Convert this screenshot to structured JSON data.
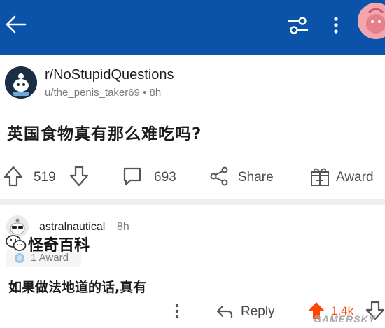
{
  "colors": {
    "header": "#0b53a8",
    "upvote_active": "#ff4500",
    "muted": "#7c7c7c"
  },
  "header": {
    "back_icon": "arrow-left-icon",
    "filter_icon": "sliders-icon",
    "more_icon": "vertical-dots-icon"
  },
  "post": {
    "subreddit": "r/NoStupidQuestions",
    "author": "u/the_penis_taker69",
    "separator": "•",
    "age": "8h",
    "title": "英国食物真有那么难吃吗?",
    "votes": "519",
    "comments": "693",
    "share_label": "Share",
    "award_label": "Award"
  },
  "comment": {
    "author": "astralnautical",
    "age": "8h",
    "award_count": "1 Award",
    "body": "如果做法地道的话,真有",
    "reply_label": "Reply",
    "score": "1.4k"
  },
  "watermarks": {
    "wechat_text": "怪奇百科",
    "site_text": "GAMERSKY"
  }
}
